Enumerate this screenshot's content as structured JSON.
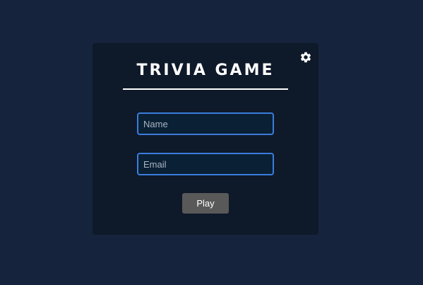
{
  "card": {
    "title": "Trivia Game",
    "settings_icon": "gear-icon"
  },
  "form": {
    "name_placeholder": "Name",
    "email_placeholder": "Email",
    "name_value": "",
    "email_value": "",
    "play_label": "Play"
  },
  "colors": {
    "page_background": "#16233c",
    "card_background": "#0e192a",
    "input_border": "#3b7ddb",
    "button_background": "#595959"
  }
}
